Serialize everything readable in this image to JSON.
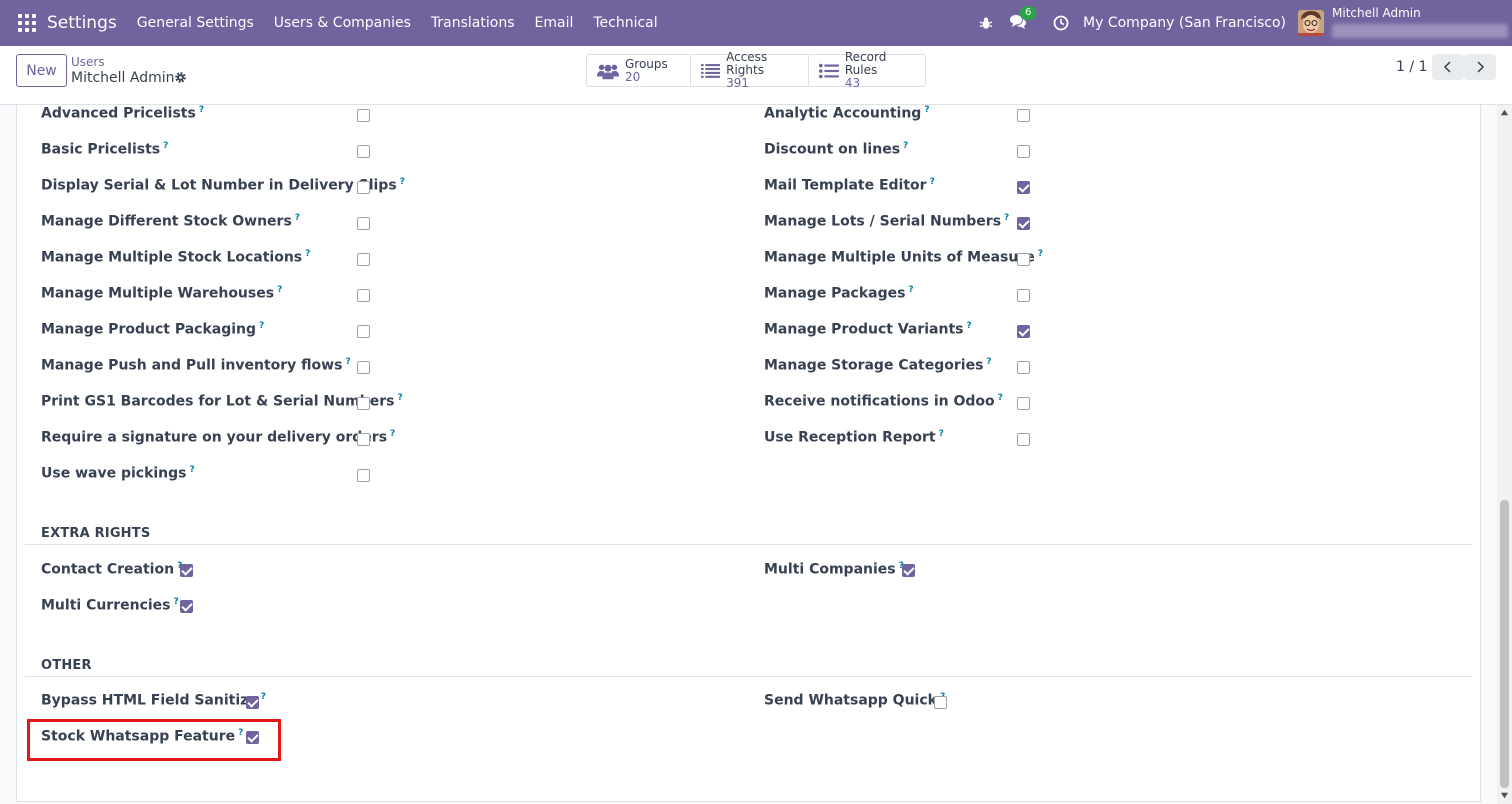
{
  "navbar": {
    "app_name": "Settings",
    "menu": [
      "General Settings",
      "Users & Companies",
      "Translations",
      "Email",
      "Technical"
    ],
    "chat_badge": "6",
    "company": "My Company (San Francisco)",
    "user_name": "Mitchell Admin"
  },
  "control": {
    "new_label": "New",
    "breadcrumb_parent": "Users",
    "breadcrumb_current": "Mitchell Admin",
    "stats": [
      {
        "label": "Groups",
        "value": "20",
        "icon": "users-icon"
      },
      {
        "label": "Access Rights",
        "value": "391",
        "icon": "list-icon"
      },
      {
        "label": "Record Rules",
        "value": "43",
        "icon": "list-icon"
      }
    ],
    "pager": "1 / 1"
  },
  "technical_settings": {
    "left": [
      {
        "label": "Advanced Pricelists",
        "checked": false
      },
      {
        "label": "Basic Pricelists",
        "checked": false
      },
      {
        "label": "Display Serial & Lot Number in Delivery Slips",
        "checked": false
      },
      {
        "label": "Manage Different Stock Owners",
        "checked": false
      },
      {
        "label": "Manage Multiple Stock Locations",
        "checked": false
      },
      {
        "label": "Manage Multiple Warehouses",
        "checked": false
      },
      {
        "label": "Manage Product Packaging",
        "checked": false
      },
      {
        "label": "Manage Push and Pull inventory flows",
        "checked": false
      },
      {
        "label": "Print GS1 Barcodes for Lot & Serial Numbers",
        "checked": false
      },
      {
        "label": "Require a signature on your delivery orders",
        "checked": false
      },
      {
        "label": "Use wave pickings",
        "checked": false
      }
    ],
    "right": [
      {
        "label": "Analytic Accounting",
        "checked": false
      },
      {
        "label": "Discount on lines",
        "checked": false
      },
      {
        "label": "Mail Template Editor",
        "checked": true
      },
      {
        "label": "Manage Lots / Serial Numbers",
        "checked": true
      },
      {
        "label": "Manage Multiple Units of Measure",
        "checked": false
      },
      {
        "label": "Manage Packages",
        "checked": false
      },
      {
        "label": "Manage Product Variants",
        "checked": true
      },
      {
        "label": "Manage Storage Categories",
        "checked": false
      },
      {
        "label": "Receive notifications in Odoo",
        "checked": false
      },
      {
        "label": "Use Reception Report",
        "checked": false
      }
    ]
  },
  "extra_rights": {
    "title": "EXTRA RIGHTS",
    "items": [
      {
        "label": "Contact Creation",
        "checked": true
      },
      {
        "label": "Multi Companies",
        "checked": true
      },
      {
        "label": "Multi Currencies",
        "checked": true
      }
    ]
  },
  "other": {
    "title": "OTHER",
    "items": [
      {
        "label": "Bypass HTML Field Sanitize",
        "checked": true
      },
      {
        "label": "Send Whatsapp Quick",
        "checked": false
      },
      {
        "label": "Stock Whatsapp Feature",
        "checked": true
      }
    ]
  },
  "help_mark": "?",
  "colors": {
    "brand": "#71639e",
    "highlight": "#e01818",
    "help": "#0180a5"
  }
}
